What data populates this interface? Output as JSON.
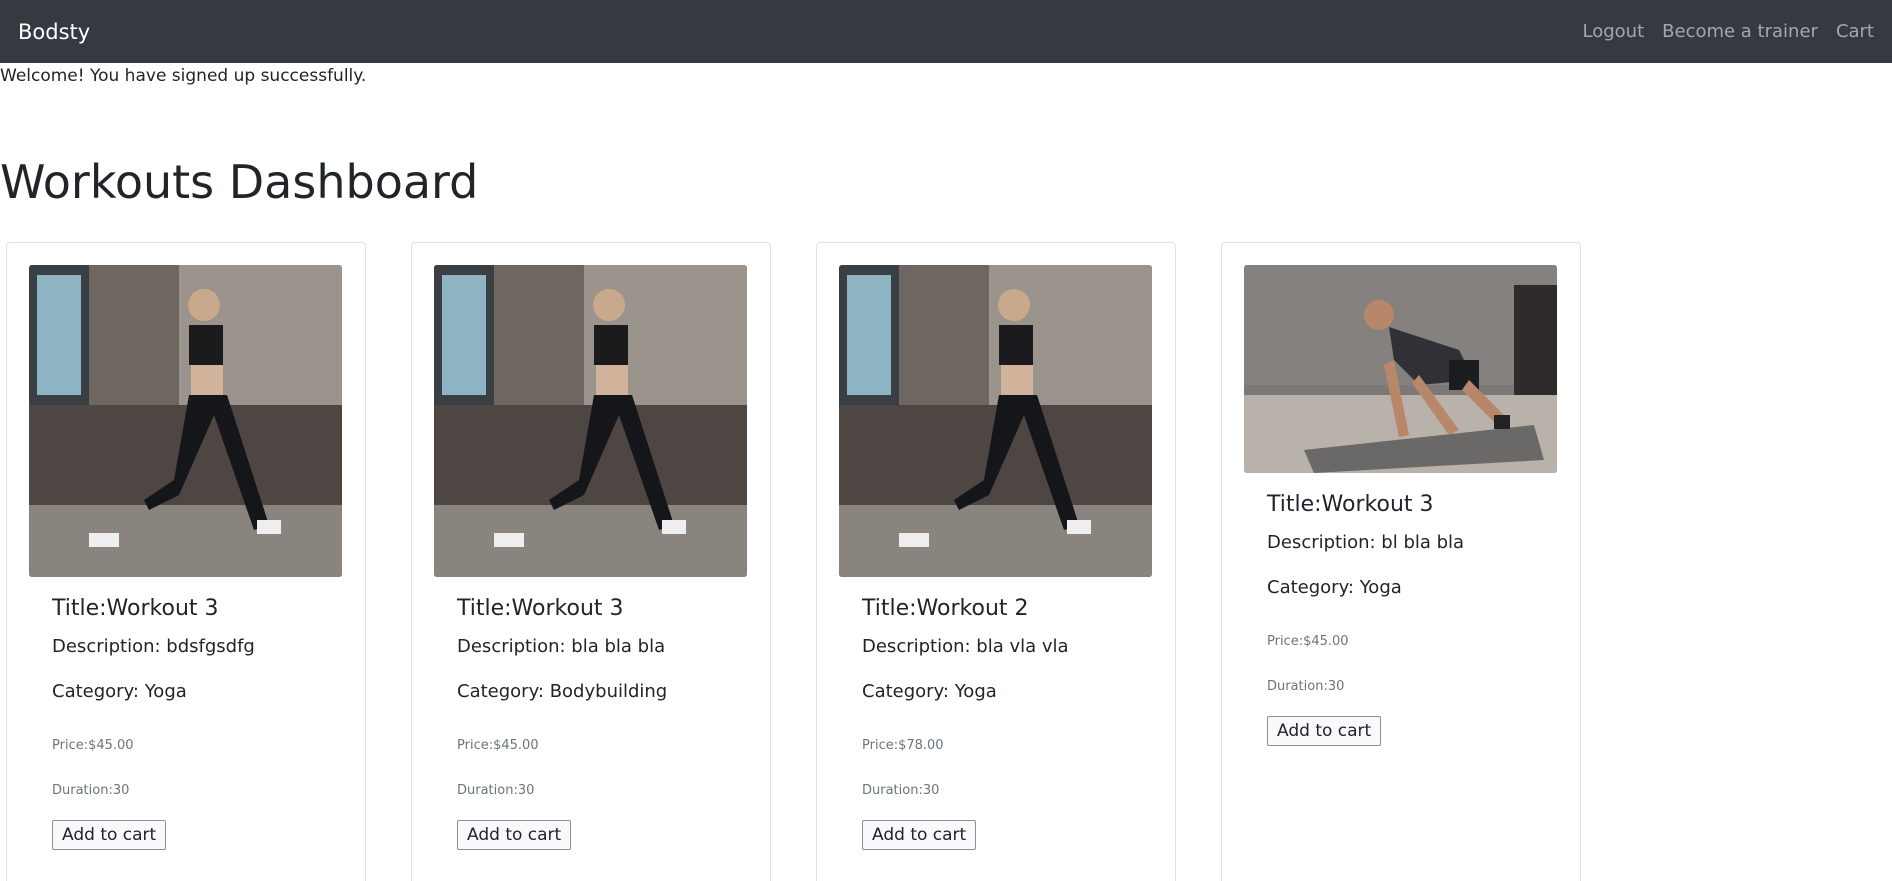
{
  "navbar": {
    "brand": "Bodsty",
    "links": [
      "Logout",
      "Become a trainer",
      "Cart"
    ]
  },
  "flash_message": "Welcome! You have signed up successfully.",
  "page_title": "Workouts Dashboard",
  "workouts": [
    {
      "title": "Title:Workout 3",
      "description": "Description: bdsfgsdfg",
      "category": "Category: Yoga",
      "price": "Price:$45.00",
      "duration": "Duration:30",
      "button": "Add to cart",
      "image": "woman-lunge-photo"
    },
    {
      "title": "Title:Workout 3",
      "description": "Description: bla bla bla",
      "category": "Category: Bodybuilding",
      "price": "Price:$45.00",
      "duration": "Duration:30",
      "button": "Add to cart",
      "image": "woman-lunge-photo"
    },
    {
      "title": "Title:Workout 2",
      "description": "Description: bla vla vla",
      "category": "Category: Yoga",
      "price": "Price:$78.00",
      "duration": "Duration:30",
      "button": "Add to cart",
      "image": "woman-lunge-photo"
    },
    {
      "title": "Title:Workout 3",
      "description": "Description: bl bla bla",
      "category": "Category: Yoga",
      "price": "Price:$45.00",
      "duration": "Duration:30",
      "button": "Add to cart",
      "image": "man-mountain-climber-photo"
    }
  ]
}
